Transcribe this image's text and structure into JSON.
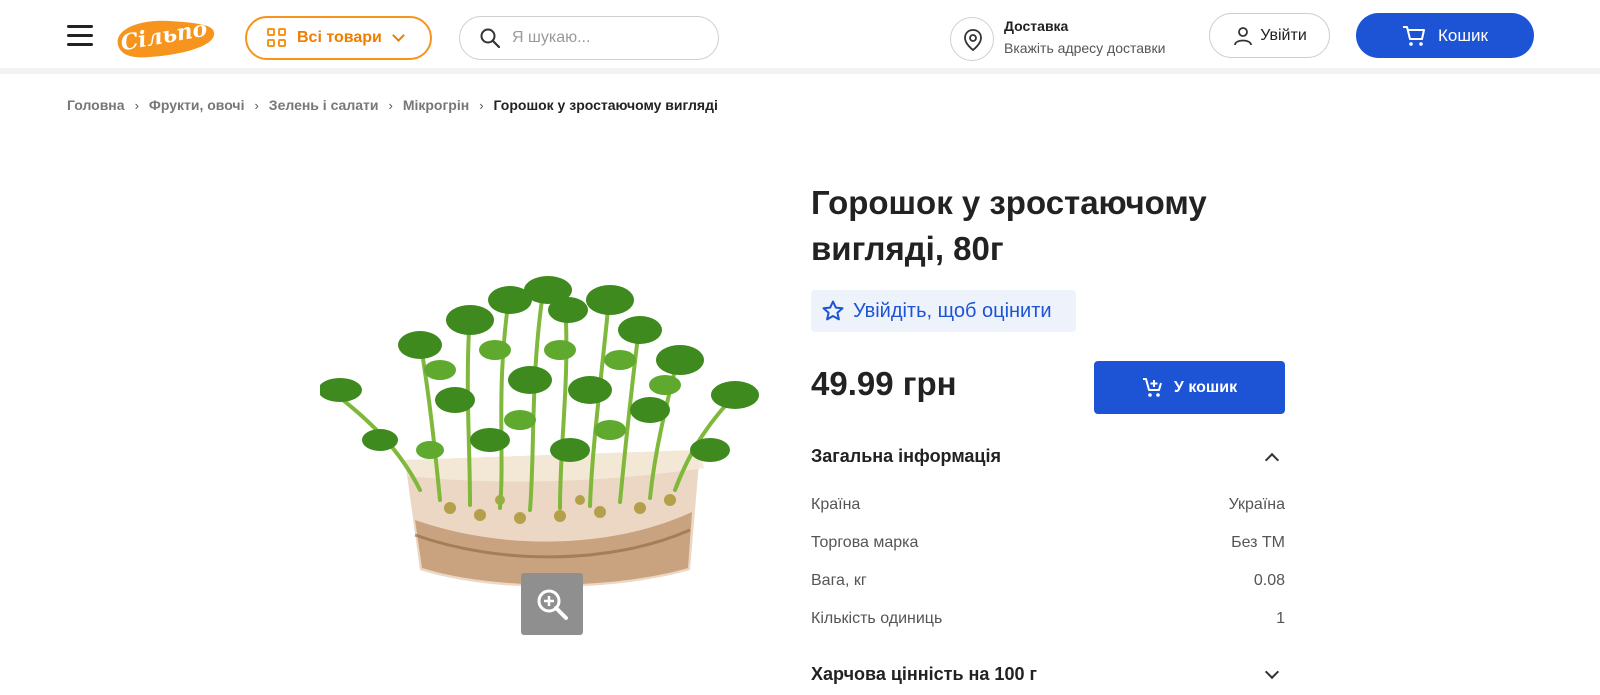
{
  "header": {
    "logo_text": "Сільпо",
    "all_goods_label": "Всі товари",
    "search_placeholder": "Я шукаю...",
    "delivery_title": "Доставка",
    "delivery_subtitle": "Вкажіть адресу доставки",
    "login_label": "Увійти",
    "cart_label": "Кошик"
  },
  "breadcrumbs": [
    "Головна",
    "Фрукти, овочі",
    "Зелень і салати",
    "Мікрогрін"
  ],
  "breadcrumb_current": "Горошок у зростаючому вигляді",
  "product": {
    "title": "Горошок у зростаючому вигляді, 80г",
    "rate_label": "Увійдіть, щоб оцінити",
    "price": "49.99 грн",
    "add_to_cart_label": "У кошик"
  },
  "general_info": {
    "heading": "Загальна інформація",
    "rows": [
      {
        "label": "Країна",
        "value": "Україна"
      },
      {
        "label": "Торгова марка",
        "value": "Без ТМ"
      },
      {
        "label": "Вага, кг",
        "value": "0.08"
      },
      {
        "label": "Кількість одиниць",
        "value": "1"
      }
    ]
  },
  "nutrition": {
    "heading": "Харчова цінність на 100 г"
  },
  "colors": {
    "brand_orange": "#f7941d",
    "accent_blue": "#1d54d6"
  },
  "icons": [
    "menu-icon",
    "grid-icon",
    "chevron-down-icon",
    "search-icon",
    "location-pin-icon",
    "user-icon",
    "cart-icon",
    "star-icon",
    "add-to-cart-icon",
    "zoom-in-icon",
    "chevron-up-icon"
  ]
}
